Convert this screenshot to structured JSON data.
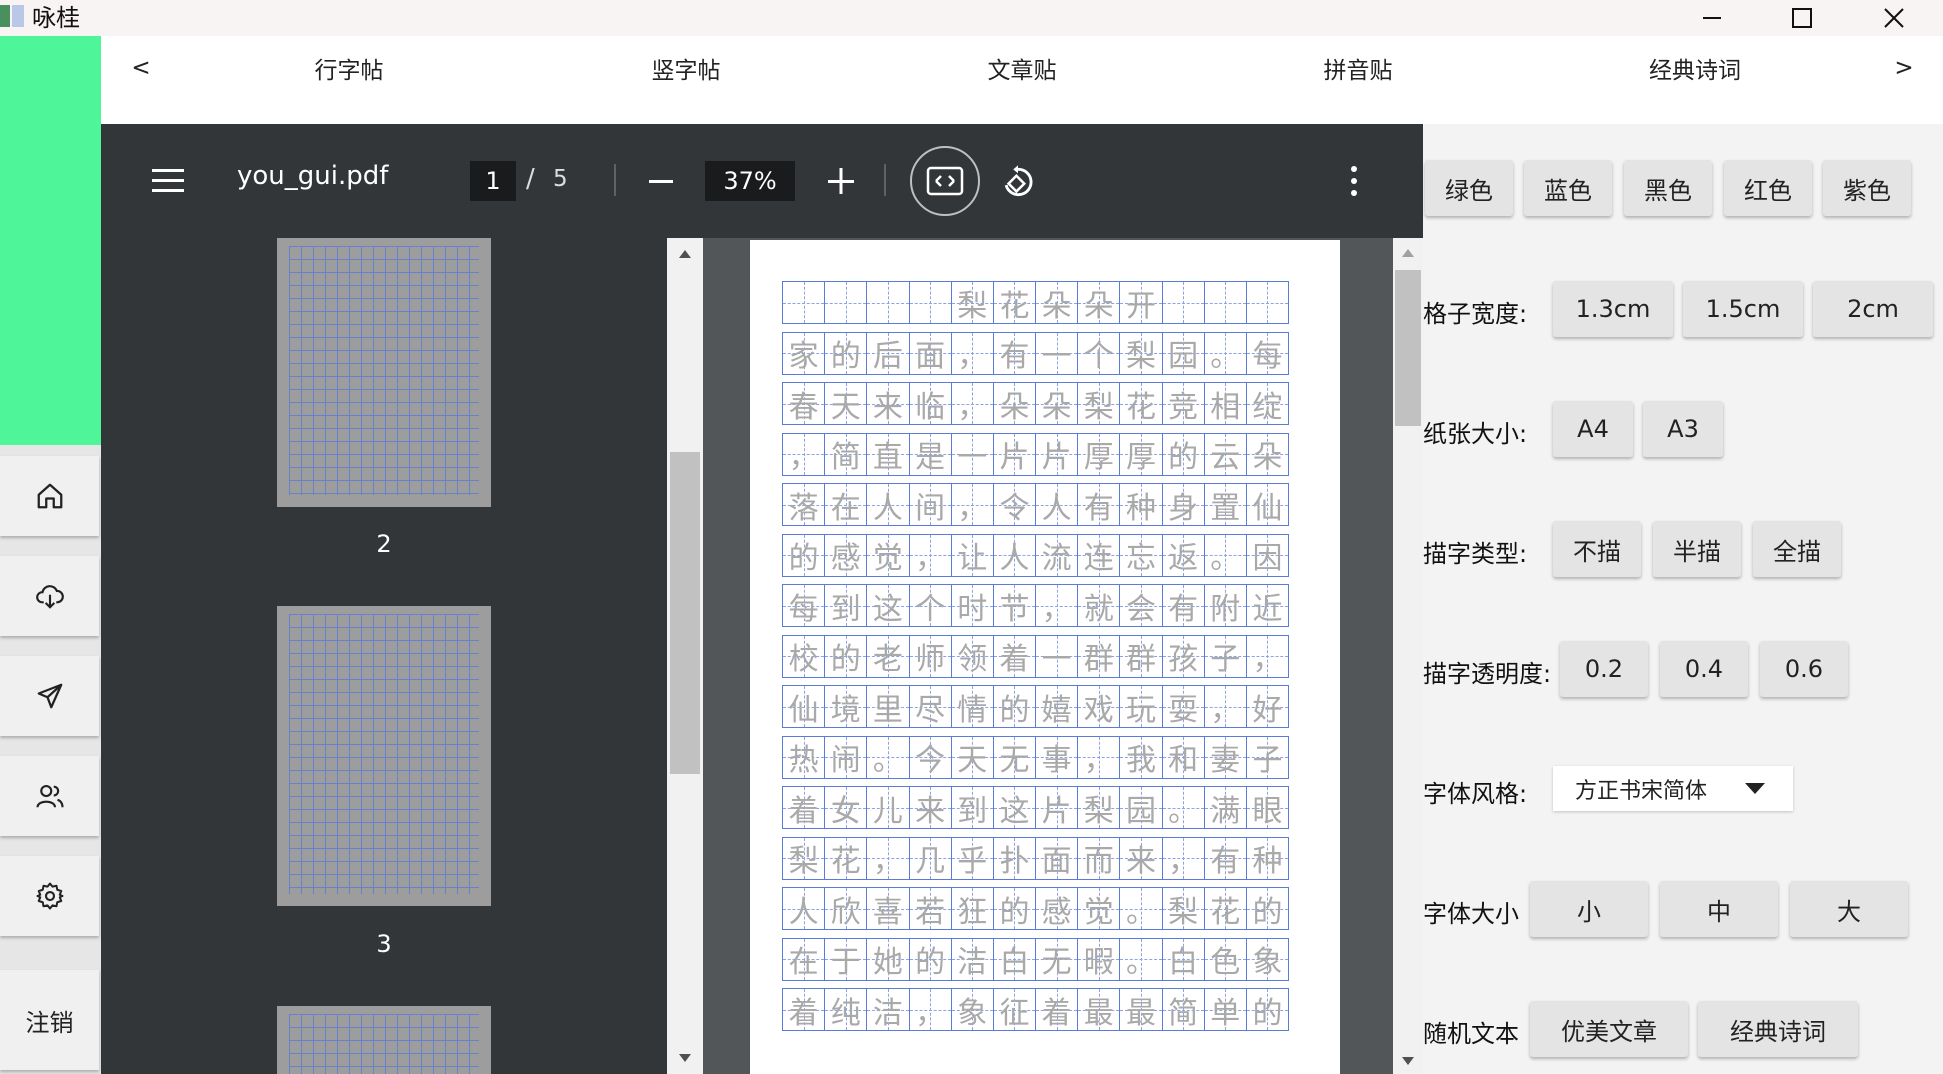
{
  "window": {
    "title": "咏桂"
  },
  "tabs": {
    "prev": "<",
    "next": ">",
    "items": [
      "行字帖",
      "竖字帖",
      "文章贴",
      "拼音贴",
      "经典诗词"
    ]
  },
  "sidebar": {
    "logout": "注销",
    "icons": [
      "home-icon",
      "download-icon",
      "send-icon",
      "users-icon",
      "gear-icon"
    ]
  },
  "pdf": {
    "filename": "you_gui.pdf",
    "page_current": "1",
    "page_sep": "/",
    "page_total": "5",
    "zoom": "37%",
    "thumbnails": [
      "2",
      "3"
    ]
  },
  "document": {
    "rows": [
      "    梨花朵朵开   ",
      "家的后面，有一个梨园。每",
      "春天来临，朵朵梨花竞相绽",
      "，简直是一片片厚厚的云朵",
      "落在人间，令人有种身置仙",
      "的感觉，让人流连忘返。因",
      "每到这个时节，就会有附近",
      "校的老师领着一群群孩子，",
      "仙境里尽情的嬉戏玩耍，好",
      "热闹。今天无事，我和妻子",
      "着女儿来到这片梨园。满眼",
      "梨花，几乎扑面而来，有种",
      "人欣喜若狂的感觉。梨花的",
      "在于她的洁白无暇。白色象",
      "着纯洁，象征着最最简单的"
    ]
  },
  "settings": {
    "colors": [
      "绿色",
      "蓝色",
      "黑色",
      "红色",
      "紫色"
    ],
    "grid_width": {
      "label": "格子宽度:",
      "options": [
        "1.3cm",
        "1.5cm",
        "2cm"
      ]
    },
    "paper_size": {
      "label": "纸张大小:",
      "options": [
        "A4",
        "A3"
      ]
    },
    "trace_type": {
      "label": "描字类型:",
      "options": [
        "不描",
        "半描",
        "全描"
      ]
    },
    "trace_opacity": {
      "label": "描字透明度:",
      "options": [
        "0.2",
        "0.4",
        "0.6"
      ]
    },
    "font_style": {
      "label": "字体风格:",
      "selected": "方正书宋简体"
    },
    "font_size": {
      "label": "字体大小",
      "options": [
        "小",
        "中",
        "大"
      ]
    },
    "random_text": {
      "label": "随机文本",
      "options": [
        "优美文章",
        "经典诗词"
      ]
    }
  },
  "colors": {
    "accent": "#4ff599",
    "viewer_dark": "#323639",
    "grid_blue": "#5b7bd8"
  }
}
